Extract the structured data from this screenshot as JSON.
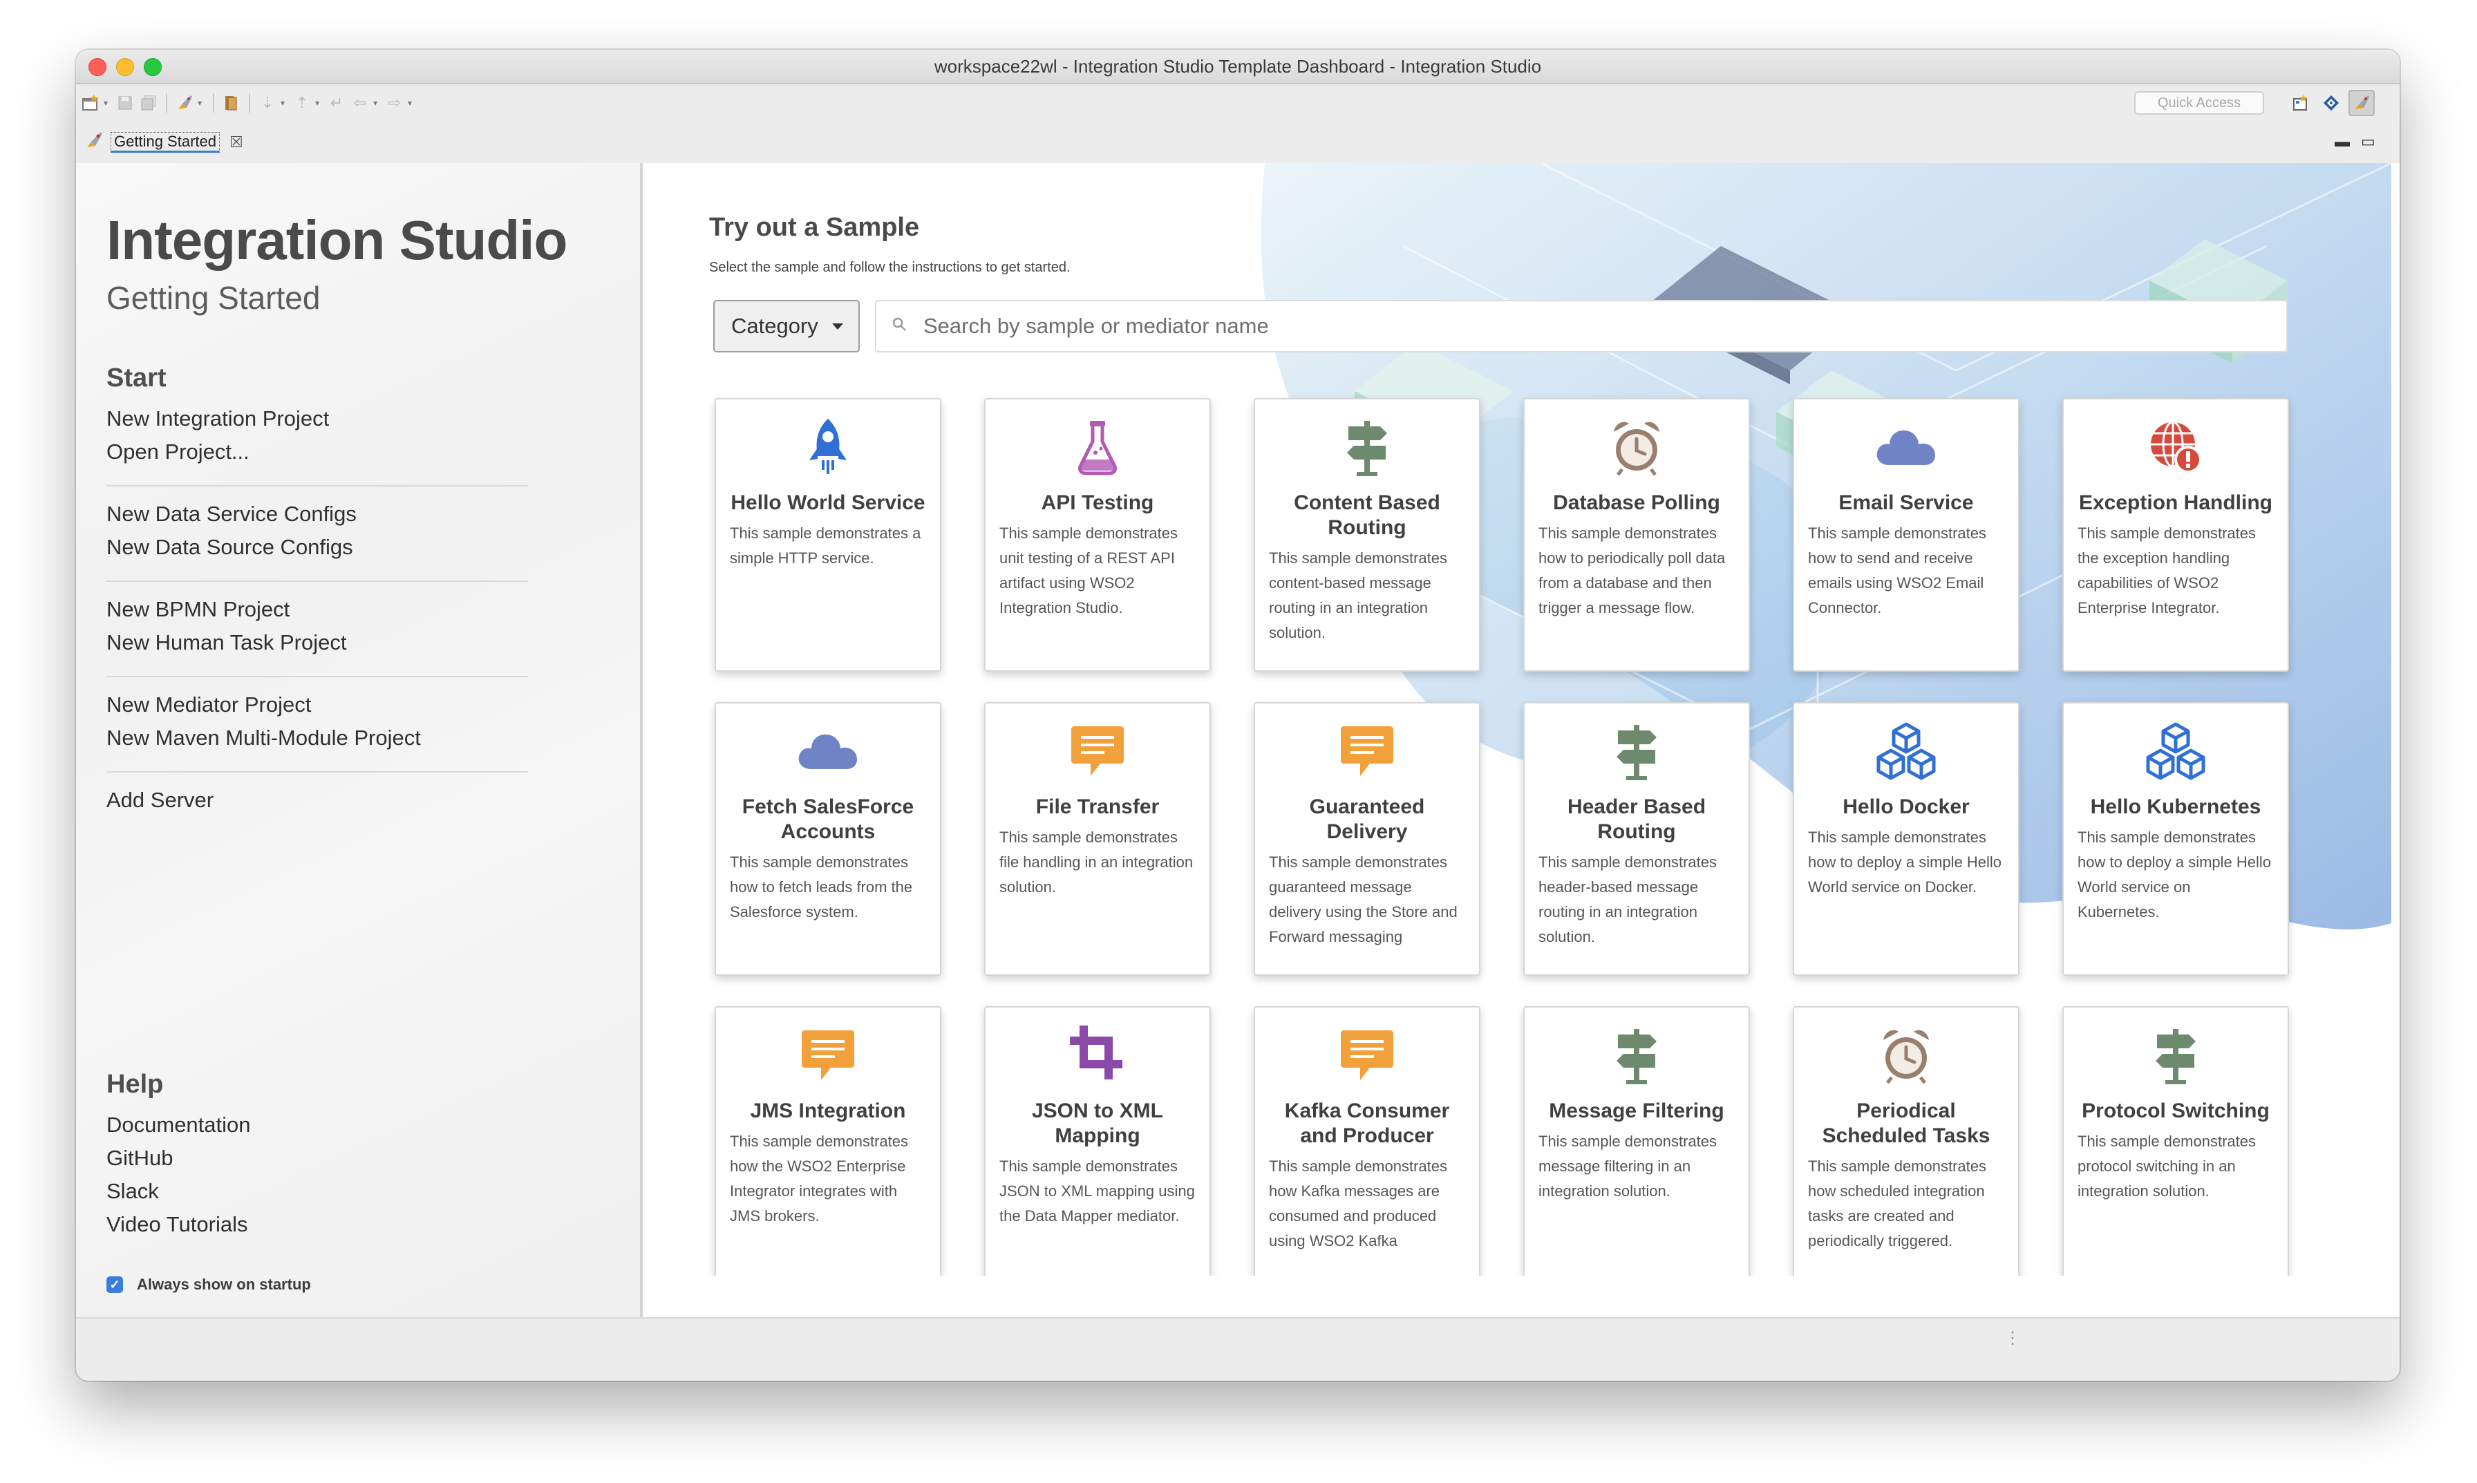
{
  "window": {
    "title": "workspace22wl - Integration Studio Template Dashboard - Integration Studio"
  },
  "toolbar": {
    "quick_access": "Quick Access",
    "icons": [
      "new-wizard-icon",
      "save-icon",
      "save-all-icon",
      "launch-icon",
      "library-icon",
      "search-annotation-icon",
      "annotation-icon",
      "back-icon",
      "forward-icon"
    ]
  },
  "tab": {
    "label": "Getting Started",
    "close": "☒"
  },
  "sidebar": {
    "title": "Integration Studio",
    "subtitle": "Getting Started",
    "start_title": "Start",
    "groups": [
      [
        "New Integration Project",
        "Open Project..."
      ],
      [
        "New Data Service Configs",
        "New Data Source Configs"
      ],
      [
        "New BPMN Project",
        "New Human Task Project"
      ],
      [
        "New Mediator Project",
        "New Maven Multi-Module Project"
      ],
      [
        "Add Server"
      ]
    ],
    "help_title": "Help",
    "help_links": [
      "Documentation",
      "GitHub",
      "Slack",
      "Video Tutorials"
    ],
    "startup_label": "Always show on startup",
    "startup_checked": true
  },
  "main": {
    "title": "Try out a Sample",
    "subtitle": "Select the sample and follow the instructions to get started.",
    "category_label": "Category",
    "search_placeholder": "Search by sample or mediator name"
  },
  "samples": [
    {
      "title": "Hello World Service",
      "desc": "This sample demonstrates a simple HTTP service.",
      "icon": "rocket-icon",
      "color": "#2f6fd6"
    },
    {
      "title": "API Testing",
      "desc": "This sample demonstrates unit testing of a REST API artifact using WSO2 Integration Studio.",
      "icon": "flask-icon",
      "color": "#b35ab3"
    },
    {
      "title": "Content Based Routing",
      "desc": "This sample demonstrates content-based message routing in an integration solution.",
      "icon": "signpost-icon",
      "color": "#6e8a6e"
    },
    {
      "title": "Database Polling",
      "desc": "This sample demonstrates how to periodically poll data from a database and then trigger a message flow.",
      "icon": "alarm-clock-icon",
      "color": "#9a7e6e"
    },
    {
      "title": "Email Service",
      "desc": "This sample demonstrates how to send and receive emails using WSO2 Email Connector.",
      "icon": "cloud-icon",
      "color": "#6f83c5"
    },
    {
      "title": "Exception Handling",
      "desc": "This sample demonstrates the exception handling capabilities of WSO2 Enterprise Integrator.",
      "icon": "globe-error-icon",
      "color": "#d64a3b"
    },
    {
      "title": "Fetch SalesForce Accounts",
      "desc": "This sample demonstrates how to fetch leads from the Salesforce system.",
      "icon": "cloud-icon",
      "color": "#6f83c5"
    },
    {
      "title": "File Transfer",
      "desc": "This sample demonstrates file handling in an integration solution.",
      "icon": "message-icon",
      "color": "#f2a03a"
    },
    {
      "title": "Guaranteed Delivery",
      "desc": "This sample demonstrates guaranteed message delivery using the Store and Forward messaging",
      "icon": "message-icon",
      "color": "#f2a03a"
    },
    {
      "title": "Header Based Routing",
      "desc": "This sample demonstrates header-based message routing in an integration solution.",
      "icon": "signpost-icon",
      "color": "#6e8a6e"
    },
    {
      "title": "Hello Docker",
      "desc": "This sample demonstrates how to deploy a simple Hello World service on Docker.",
      "icon": "cubes-icon",
      "color": "#2f6fd6"
    },
    {
      "title": "Hello Kubernetes",
      "desc": "This sample demonstrates how to deploy a simple Hello World service on Kubernetes.",
      "icon": "cubes-icon",
      "color": "#2f6fd6"
    },
    {
      "title": "JMS Integration",
      "desc": "This sample demonstrates how the WSO2 Enterprise Integrator integrates with JMS brokers.",
      "icon": "message-icon",
      "color": "#f2a03a"
    },
    {
      "title": "JSON to XML Mapping",
      "desc": "This sample demonstrates JSON to XML mapping using the Data Mapper mediator.",
      "icon": "crop-icon",
      "color": "#8c4aa8"
    },
    {
      "title": "Kafka Consumer and Producer",
      "desc": "This sample demonstrates how Kafka messages are consumed and produced using WSO2 Kafka",
      "icon": "message-icon",
      "color": "#f2a03a"
    },
    {
      "title": "Message Filtering",
      "desc": "This sample demonstrates message filtering in an integration solution.",
      "icon": "signpost-icon",
      "color": "#6e8a6e"
    },
    {
      "title": "Periodical Scheduled Tasks",
      "desc": "This sample demonstrates how scheduled integration tasks are created and periodically triggered.",
      "icon": "alarm-clock-icon",
      "color": "#9a7e6e"
    },
    {
      "title": "Protocol Switching",
      "desc": "This sample demonstrates protocol switching in an integration solution.",
      "icon": "signpost-icon",
      "color": "#6e8a6e"
    }
  ]
}
